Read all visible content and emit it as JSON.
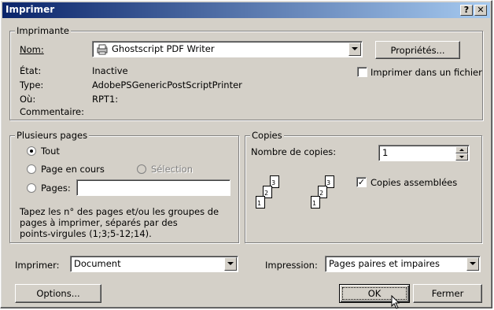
{
  "window": {
    "title": "Imprimer",
    "help_label": "?",
    "close_label": "✕"
  },
  "printer": {
    "legend": "Imprimante",
    "name_label": "Nom:",
    "name_value": "Ghostscript PDF Writer",
    "properties_label": "Propriétés...",
    "state_label": "État:",
    "state_value": "Inactive",
    "type_label": "Type:",
    "type_value": "AdobePSGenericPostScriptPrinter",
    "where_label": "Où:",
    "where_value": "RPT1:",
    "comment_label": "Commentaire:",
    "print_to_file_label": "Imprimer dans un fichier",
    "print_to_file_checked": false
  },
  "pages": {
    "legend": "Plusieurs pages",
    "all_label": "Tout",
    "current_label": "Page en cours",
    "selection_label": "Sélection",
    "pages_label": "Pages:",
    "pages_value": "",
    "help_text_1": "Tapez les n° des pages et/ou les groupes de",
    "help_text_2": "pages à imprimer, séparés par des",
    "help_text_3": "points-virgules (1;3;5-12;14).",
    "selected": "all"
  },
  "copies": {
    "legend": "Copies",
    "count_label": "Nombre de copies:",
    "count_value": "1",
    "collate_label": "Copies assemblées",
    "collate_checked": true,
    "page_numbers": [
      "1",
      "2",
      "3"
    ]
  },
  "print_what": {
    "label": "Imprimer:",
    "value": "Document"
  },
  "print_range": {
    "label": "Impression:",
    "value": "Pages paires et impaires"
  },
  "buttons": {
    "options": "Options...",
    "ok": "OK",
    "cancel": "Fermer"
  },
  "icons": {
    "printer": "printer-icon",
    "cursor": "mouse-cursor-icon"
  }
}
